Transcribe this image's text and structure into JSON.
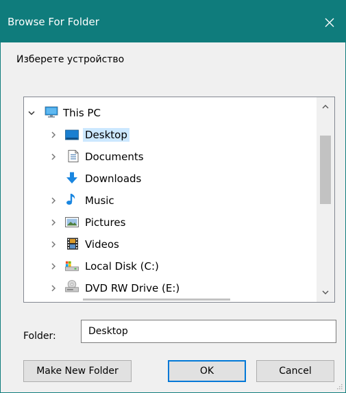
{
  "window": {
    "title": "Browse For Folder",
    "accent_color": "#0f7c7c",
    "close_icon": "close-icon"
  },
  "prompt_text": "Изберете устройство",
  "tree": {
    "items": [
      {
        "label": "This PC",
        "icon": "computer-icon",
        "chevron": "expanded",
        "selected": false
      },
      {
        "label": "Desktop",
        "icon": "desktop-icon",
        "chevron": "collapsed",
        "selected": true
      },
      {
        "label": "Documents",
        "icon": "documents-icon",
        "chevron": "collapsed",
        "selected": false
      },
      {
        "label": "Downloads",
        "icon": "downloads-icon",
        "chevron": "none",
        "selected": false
      },
      {
        "label": "Music",
        "icon": "music-icon",
        "chevron": "collapsed",
        "selected": false
      },
      {
        "label": "Pictures",
        "icon": "pictures-icon",
        "chevron": "collapsed",
        "selected": false
      },
      {
        "label": "Videos",
        "icon": "videos-icon",
        "chevron": "collapsed",
        "selected": false
      },
      {
        "label": "Local Disk (C:)",
        "icon": "local-disk-icon",
        "chevron": "collapsed",
        "selected": false
      },
      {
        "label": "DVD RW Drive (E:)",
        "icon": "dvd-drive-icon",
        "chevron": "collapsed",
        "selected": false
      }
    ],
    "selection_color": "#cce8ff"
  },
  "folder": {
    "label": "Folder:",
    "value": "Desktop"
  },
  "buttons": {
    "make_new_folder": "Make New Folder",
    "ok": "OK",
    "cancel": "Cancel"
  }
}
